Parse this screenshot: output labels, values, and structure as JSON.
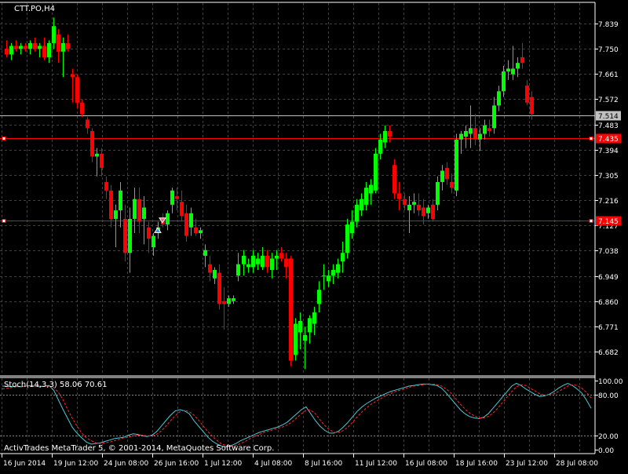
{
  "symbol_label": "CTT.PO,H4",
  "footer": "ActivTrades MetaTrader 5, © 2001-2014, MetaQuotes Software Corp.",
  "colors": {
    "background": "#000000",
    "grid": "#404040",
    "up": "#00ff00",
    "down": "#ff0000",
    "text": "#ffffff",
    "hline": "#ff0000",
    "current": "#c0c0c0",
    "stoch_main": "#4ec9d6",
    "stoch_signal": "#ff2a2a"
  },
  "chart_data": [
    {
      "type": "candlestick",
      "title": "CTT.PO,H4",
      "y_ticks": [
        "7.839",
        "7.750",
        "7.661",
        "7.572",
        "7.483",
        "7.394",
        "7.305",
        "7.216",
        "7.127",
        "7.038",
        "6.949",
        "6.860",
        "6.771",
        "6.682"
      ],
      "ylim": [
        6.6,
        7.87
      ],
      "x_ticks": [
        "16 Jun 2014",
        "19 Jun 12:00",
        "24 Jun 08:00",
        "26 Jun 16:00",
        "1 Jul 12:00",
        "4 Jul 08:00",
        "8 Jul 16:00",
        "11 Jul 12:00",
        "16 Jul 08:00",
        "18 Jul 16:00",
        "23 Jul 12:00",
        "28 Jul 08:00"
      ],
      "current_price": "7.514",
      "horizontal_lines": [
        {
          "label": "7.435",
          "value": 7.435
        },
        {
          "label": "7.145",
          "value": 7.145
        }
      ],
      "markers": [
        {
          "type": "sell",
          "index": 33,
          "value": 7.145
        },
        {
          "type": "buy",
          "index": 32,
          "value": 7.11
        }
      ],
      "candles": [
        [
          7.75,
          7.78,
          7.72,
          7.73
        ],
        [
          7.73,
          7.77,
          7.71,
          7.76
        ],
        [
          7.76,
          7.78,
          7.74,
          7.75
        ],
        [
          7.75,
          7.77,
          7.73,
          7.76
        ],
        [
          7.76,
          7.77,
          7.74,
          7.75
        ],
        [
          7.75,
          7.78,
          7.73,
          7.77
        ],
        [
          7.77,
          7.79,
          7.74,
          7.75
        ],
        [
          7.75,
          7.77,
          7.72,
          7.76
        ],
        [
          7.76,
          7.79,
          7.71,
          7.72
        ],
        [
          7.72,
          7.78,
          7.7,
          7.77
        ],
        [
          7.77,
          7.86,
          7.75,
          7.83
        ],
        [
          7.8,
          7.82,
          7.7,
          7.74
        ],
        [
          7.74,
          7.79,
          7.65,
          7.77
        ],
        [
          7.77,
          7.8,
          7.74,
          7.75
        ],
        [
          7.66,
          7.68,
          7.56,
          7.65
        ],
        [
          7.65,
          7.66,
          7.54,
          7.56
        ],
        [
          7.56,
          7.57,
          7.51,
          7.52
        ],
        [
          7.5,
          7.51,
          7.45,
          7.47
        ],
        [
          7.46,
          7.47,
          7.35,
          7.37
        ],
        [
          7.37,
          7.4,
          7.3,
          7.38
        ],
        [
          7.38,
          7.4,
          7.3,
          7.33
        ],
        [
          7.28,
          7.3,
          7.22,
          7.25
        ],
        [
          7.25,
          7.27,
          7.12,
          7.15
        ],
        [
          7.15,
          7.2,
          7.05,
          7.18
        ],
        [
          7.18,
          7.28,
          7.12,
          7.25
        ],
        [
          7.15,
          7.2,
          7.0,
          7.03
        ],
        [
          7.03,
          7.19,
          6.96,
          7.15
        ],
        [
          7.15,
          7.26,
          7.1,
          7.22
        ],
        [
          7.22,
          7.26,
          7.1,
          7.14
        ],
        [
          7.15,
          7.23,
          7.06,
          7.19
        ],
        [
          7.12,
          7.14,
          7.03,
          7.08
        ],
        [
          7.05,
          7.1,
          7.02,
          7.09
        ],
        [
          7.1,
          7.14,
          7.08,
          7.12
        ],
        [
          7.15,
          7.17,
          7.12,
          7.13
        ],
        [
          7.13,
          7.18,
          7.11,
          7.17
        ],
        [
          7.2,
          7.26,
          7.17,
          7.25
        ],
        [
          7.23,
          7.26,
          7.18,
          7.22
        ],
        [
          7.21,
          7.25,
          7.14,
          7.16
        ],
        [
          7.17,
          7.2,
          7.07,
          7.09
        ],
        [
          7.12,
          7.19,
          7.09,
          7.17
        ],
        [
          7.12,
          7.15,
          7.09,
          7.1
        ],
        [
          7.1,
          7.12,
          7.08,
          7.11
        ],
        [
          7.02,
          7.06,
          6.98,
          7.04
        ],
        [
          6.99,
          7.02,
          6.93,
          6.96
        ],
        [
          6.94,
          6.98,
          6.92,
          6.97
        ],
        [
          6.96,
          6.99,
          6.83,
          6.85
        ],
        [
          6.86,
          6.91,
          6.76,
          6.85
        ],
        [
          6.85,
          6.88,
          6.84,
          6.87
        ],
        [
          6.86,
          6.88,
          6.85,
          6.87
        ],
        [
          6.95,
          7.03,
          6.93,
          6.99
        ],
        [
          6.99,
          7.04,
          6.95,
          7.02
        ],
        [
          6.98,
          7.01,
          6.96,
          6.99
        ],
        [
          6.98,
          7.04,
          6.96,
          7.02
        ],
        [
          6.99,
          7.03,
          6.97,
          7.01
        ],
        [
          6.98,
          7.05,
          6.97,
          7.02
        ],
        [
          7.02,
          7.04,
          6.96,
          6.98
        ],
        [
          6.97,
          7.03,
          6.94,
          7.01
        ],
        [
          7.01,
          7.04,
          6.97,
          7.02
        ],
        [
          7.03,
          7.05,
          7.0,
          7.01
        ],
        [
          7.01,
          7.03,
          6.94,
          6.98
        ],
        [
          7.01,
          7.02,
          6.63,
          6.65
        ],
        [
          6.67,
          6.8,
          6.65,
          6.78
        ],
        [
          6.75,
          6.82,
          6.69,
          6.79
        ],
        [
          6.72,
          6.77,
          6.62,
          6.74
        ],
        [
          6.75,
          6.81,
          6.71,
          6.8
        ],
        [
          6.78,
          6.84,
          6.74,
          6.82
        ],
        [
          6.85,
          6.93,
          6.82,
          6.9
        ],
        [
          6.95,
          6.99,
          6.9,
          6.95
        ],
        [
          6.93,
          6.97,
          6.91,
          6.95
        ],
        [
          6.95,
          6.99,
          6.92,
          6.97
        ],
        [
          6.96,
          7.01,
          6.94,
          6.99
        ],
        [
          7.0,
          7.07,
          6.96,
          7.03
        ],
        [
          7.03,
          7.15,
          7.01,
          7.13
        ],
        [
          7.1,
          7.18,
          7.08,
          7.14
        ],
        [
          7.14,
          7.22,
          7.12,
          7.2
        ],
        [
          7.18,
          7.24,
          7.16,
          7.22
        ],
        [
          7.2,
          7.28,
          7.18,
          7.26
        ],
        [
          7.24,
          7.29,
          7.2,
          7.27
        ],
        [
          7.25,
          7.4,
          7.24,
          7.38
        ],
        [
          7.38,
          7.45,
          7.36,
          7.43
        ],
        [
          7.42,
          7.48,
          7.4,
          7.46
        ],
        [
          7.46,
          7.48,
          7.42,
          7.44
        ],
        [
          7.34,
          7.36,
          7.22,
          7.24
        ],
        [
          7.24,
          7.28,
          7.18,
          7.22
        ],
        [
          7.22,
          7.24,
          7.18,
          7.2
        ],
        [
          7.18,
          7.23,
          7.1,
          7.2
        ],
        [
          7.2,
          7.24,
          7.17,
          7.21
        ],
        [
          7.2,
          7.24,
          7.16,
          7.18
        ],
        [
          7.19,
          7.22,
          7.13,
          7.16
        ],
        [
          7.17,
          7.2,
          7.15,
          7.19
        ],
        [
          7.2,
          7.22,
          7.14,
          7.15
        ],
        [
          7.2,
          7.3,
          7.18,
          7.28
        ],
        [
          7.28,
          7.34,
          7.25,
          7.32
        ],
        [
          7.33,
          7.35,
          7.27,
          7.29
        ],
        [
          7.28,
          7.31,
          7.24,
          7.26
        ],
        [
          7.25,
          7.45,
          7.23,
          7.43
        ],
        [
          7.43,
          7.46,
          7.38,
          7.45
        ],
        [
          7.44,
          7.48,
          7.4,
          7.46
        ],
        [
          7.45,
          7.55,
          7.4,
          7.47
        ],
        [
          7.47,
          7.52,
          7.41,
          7.43
        ],
        [
          7.43,
          7.47,
          7.39,
          7.45
        ],
        [
          7.45,
          7.5,
          7.43,
          7.48
        ],
        [
          7.47,
          7.5,
          7.44,
          7.46
        ],
        [
          7.47,
          7.58,
          7.45,
          7.55
        ],
        [
          7.55,
          7.62,
          7.53,
          7.6
        ],
        [
          7.6,
          7.69,
          7.58,
          7.67
        ],
        [
          7.67,
          7.71,
          7.64,
          7.68
        ],
        [
          7.66,
          7.76,
          7.64,
          7.68
        ],
        [
          7.68,
          7.72,
          7.65,
          7.7
        ],
        [
          7.72,
          7.77,
          7.68,
          7.7
        ],
        [
          7.62,
          7.64,
          7.55,
          7.56
        ],
        [
          7.58,
          7.6,
          7.5,
          7.52
        ]
      ]
    },
    {
      "type": "line",
      "title": "Stoch(14,3,3) 58.06 70.61",
      "y_ticks": [
        "100.00",
        "80.00",
        "20.00",
        "0.00"
      ],
      "ylim": [
        0,
        100
      ],
      "series": [
        {
          "name": "main",
          "values": [
            92,
            92,
            91,
            92,
            91,
            92,
            93,
            92,
            91,
            92,
            93,
            86,
            72,
            58,
            45,
            32,
            24,
            17,
            11,
            8,
            9,
            10,
            12,
            14,
            16,
            17,
            18,
            21,
            23,
            22,
            20,
            19,
            21,
            26,
            34,
            42,
            50,
            56,
            58,
            56,
            52,
            42,
            34,
            26,
            18,
            12,
            8,
            5,
            4,
            6,
            9,
            13,
            16,
            19,
            22,
            25,
            27,
            29,
            31,
            33,
            36,
            40,
            46,
            52,
            58,
            62,
            52,
            42,
            34,
            28,
            24,
            24,
            27,
            33,
            40,
            48,
            56,
            62,
            67,
            71,
            75,
            78,
            81,
            84,
            86,
            88,
            90,
            92,
            93,
            94,
            95,
            95,
            94,
            93,
            89,
            82,
            74,
            66,
            58,
            52,
            48,
            46,
            45,
            47,
            52,
            60,
            68,
            76,
            84,
            92,
            96,
            93,
            88,
            84,
            80,
            77,
            78,
            80,
            84,
            89,
            93,
            96,
            93,
            88,
            82,
            72,
            60
          ]
        },
        {
          "name": "signal",
          "values": [
            88,
            89,
            90,
            91,
            91,
            92,
            92,
            92,
            92,
            92,
            92,
            90,
            83,
            72,
            58,
            45,
            34,
            24,
            17,
            13,
            10,
            9,
            10,
            11,
            13,
            15,
            17,
            18,
            20,
            21,
            21,
            20,
            20,
            22,
            27,
            34,
            42,
            49,
            55,
            57,
            55,
            50,
            43,
            34,
            26,
            19,
            13,
            8,
            6,
            5,
            6,
            9,
            12,
            16,
            19,
            22,
            25,
            27,
            29,
            31,
            33,
            36,
            40,
            46,
            52,
            57,
            57,
            52,
            43,
            35,
            29,
            25,
            25,
            28,
            33,
            40,
            48,
            55,
            61,
            66,
            70,
            74,
            78,
            81,
            84,
            86,
            88,
            90,
            92,
            93,
            94,
            95,
            95,
            94,
            92,
            88,
            82,
            74,
            66,
            59,
            53,
            49,
            46,
            46,
            48,
            53,
            60,
            68,
            76,
            84,
            91,
            94,
            93,
            89,
            85,
            81,
            79,
            79,
            81,
            84,
            88,
            92,
            94,
            93,
            89,
            83,
            75
          ]
        }
      ],
      "hlines": [
        80,
        20
      ]
    }
  ]
}
